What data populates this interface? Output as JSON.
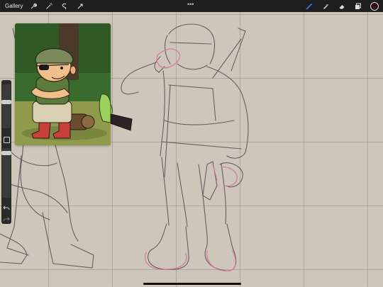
{
  "app": {
    "gallery_label": "Gallery",
    "more_label": "•••"
  },
  "tools_left": [
    {
      "name": "wrench-icon"
    },
    {
      "name": "magic-wand-icon"
    },
    {
      "name": "selection-icon"
    },
    {
      "name": "transform-arrow-icon"
    }
  ],
  "tools_right": [
    {
      "name": "brush-icon",
      "active": true
    },
    {
      "name": "smudge-icon"
    },
    {
      "name": "eraser-icon"
    },
    {
      "name": "layers-icon"
    }
  ],
  "colors": {
    "accent": "#3b7be0",
    "current_color": "#2a0d1a",
    "sketch": "#5a4a4f",
    "correction": "#d77a9a"
  },
  "sidebar": {
    "undo_icon": "undo-icon",
    "redo_icon": "redo-icon",
    "modify_icon": "square-modify-icon"
  }
}
